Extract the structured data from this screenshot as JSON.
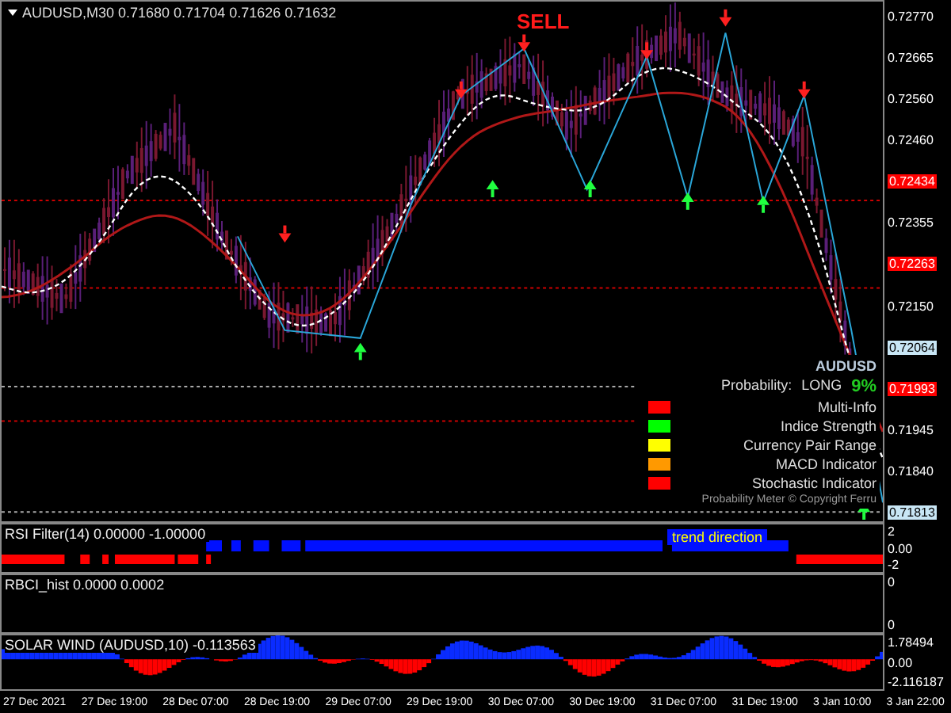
{
  "main_chart": {
    "title": "AUDUSD,M30  0.71680 0.71704 0.71626 0.71632",
    "signal": "SELL",
    "price_axis": [
      {
        "kind": "tick",
        "label": "0.72770"
      },
      {
        "kind": "tick",
        "label": "0.72665"
      },
      {
        "kind": "tick",
        "label": "0.72560"
      },
      {
        "kind": "tick",
        "label": "0.72460"
      },
      {
        "kind": "tag",
        "label": "0.72434",
        "color": "#ff0000"
      },
      {
        "kind": "tick",
        "label": "0.72355"
      },
      {
        "kind": "tag",
        "label": "0.72263",
        "color": "#ff0000"
      },
      {
        "kind": "tick",
        "label": "0.72150"
      },
      {
        "kind": "tag",
        "label": "0.72064",
        "color": "#c8e6f5"
      },
      {
        "kind": "tag",
        "label": "0.71993",
        "color": "#ff0000"
      },
      {
        "kind": "tick",
        "label": "0.71945"
      },
      {
        "kind": "tick",
        "label": "0.71840"
      },
      {
        "kind": "tag",
        "label": "0.71813",
        "color": "#c8e6f5"
      }
    ],
    "probability_meter": {
      "symbol": "AUDUSD",
      "label": "Probability:",
      "direction": "LONG",
      "percent": "9%",
      "rows": [
        {
          "label": "Multi-Info",
          "color": "#ff0000"
        },
        {
          "label": "Indice Strength",
          "color": "#00ff00"
        },
        {
          "label": "Currency Pair Range",
          "color": "#ffff00"
        },
        {
          "label": "MACD Indicator",
          "color": "#ff9900"
        },
        {
          "label": "Stochastic Indicator",
          "color": "#ff0000"
        }
      ],
      "footer": "Probability Meter © Copyright Ferru"
    }
  },
  "rsi_panel": {
    "title": "RSI Filter(14) 0.00000 -1.00000",
    "note": "trend direction",
    "axis": [
      "2",
      "0.00",
      "-2"
    ]
  },
  "rbci_panel": {
    "title": "RBCI_hist 0.0000 0.0002",
    "axis": [
      "0",
      "0"
    ]
  },
  "solar_panel": {
    "title": "SOLAR WIND (AUDUSD,10) -0.113563",
    "axis": [
      "1.78494",
      "0.00",
      "-2.116187"
    ]
  },
  "time_axis": [
    "27 Dec 2021",
    "27 Dec 19:00",
    "28 Dec 07:00",
    "28 Dec 19:00",
    "29 Dec 07:00",
    "29 Dec 19:00",
    "30 Dec 07:00",
    "30 Dec 19:00",
    "31 Dec 07:00",
    "31 Dec 19:00",
    "3 Jan 10:00",
    "3 Jan 22:00"
  ]
}
